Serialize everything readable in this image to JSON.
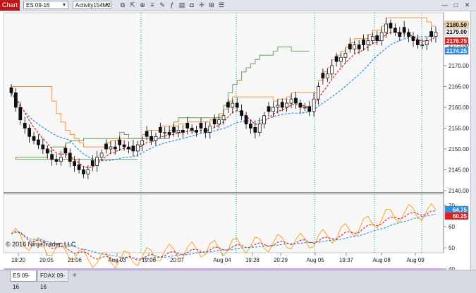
{
  "window": {
    "title": "Chart",
    "instrument": "ES 09-16",
    "period": "Activity154M2",
    "toolbar_icons": [
      "ruler-icon",
      "arrow-icon",
      "zoom-icon",
      "properties-icon",
      "drawing-icon",
      "indicators-icon",
      "data-box-icon",
      "camera-icon",
      "crosshair-icon",
      "lock-icon",
      "list-icon"
    ],
    "win_buttons": [
      "minimize-icon",
      "maximize-icon",
      "close-icon"
    ]
  },
  "chart": {
    "copyright": "© 2016 NinjaTrader, LLC",
    "price_ticks": [
      "2180.00",
      "2175.00",
      "2170.00",
      "2165.00",
      "2160.00",
      "2155.00",
      "2150.00",
      "2145.00",
      "2140.00"
    ],
    "osc_ticks": [
      "70",
      "60",
      "50",
      "40"
    ],
    "price_badges": [
      {
        "label": "2180.50",
        "bg": "#ffd9a8",
        "fg": "#000000",
        "value": 2180.5
      },
      {
        "label": "2179.00",
        "bg": "#ffffff",
        "fg": "#000000",
        "value": 2179.0
      },
      {
        "label": "2176.75",
        "bg": "#e0201f",
        "fg": "#ffffff",
        "value": 2176.75
      },
      {
        "label": "2174.25",
        "bg": "#2f8de4",
        "fg": "#ffffff",
        "value": 2174.25
      }
    ],
    "osc_badges": [
      {
        "label": "64.75",
        "bg": "#2f8de4",
        "fg": "#ffffff",
        "value": 64.75
      },
      {
        "label": "60.25",
        "bg": "#e0201f",
        "fg": "#ffffff",
        "value": 60.25
      }
    ],
    "time_labels": [
      "19:20",
      "20:05",
      "21:06",
      "Aug 03",
      "19:06",
      "20:07",
      "Aug 04",
      "19:28",
      "20:29",
      "Aug 05",
      "19:37",
      "Aug 08",
      "Aug 09"
    ],
    "colors": {
      "up_candle": "#ffffff",
      "down_candle": "#000000",
      "candle_fill_down": "#111111",
      "sma": "#2f8de4",
      "ema": "#e0201f",
      "upper_step": "#f5903a",
      "lower_step": "#6ca25f",
      "osc_line": "#f5a623",
      "osc_ref": "#a050d0",
      "session_line": "#1aa0a0"
    }
  },
  "tabs": [
    {
      "label": "ES 09-16",
      "active": true
    },
    {
      "label": "FDAX 09-16",
      "active": false
    }
  ],
  "tab_add": "+"
}
